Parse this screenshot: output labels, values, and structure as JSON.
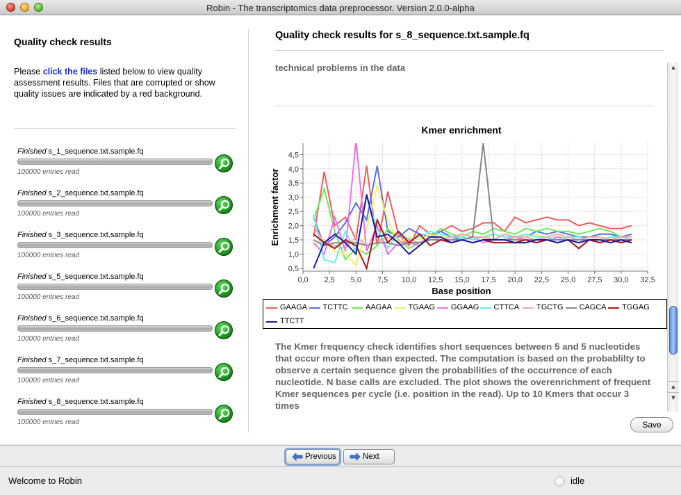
{
  "window": {
    "title": "Robin - The transcriptomics data preprocessor. Version 2.0.0-alpha"
  },
  "left": {
    "title": "Quality check results",
    "desc_prefix": "Please ",
    "desc_link": "click the files",
    "desc_suffix": " listed below to view quality assessment results. Files that are corrupted or show quality issues are indicated by a red background.",
    "files": [
      {
        "status": "Finished",
        "name": " s_1_sequence.txt.sample.fq",
        "entries": "100000 entries read"
      },
      {
        "status": "Finished",
        "name": " s_2_sequence.txt.sample.fq",
        "entries": "100000 entries read"
      },
      {
        "status": "Finished",
        "name": " s_3_sequence.txt.sample.fq",
        "entries": "100000 entries read"
      },
      {
        "status": "Finished",
        "name": " s_5_sequence.txt.sample.fq",
        "entries": "100000 entries read"
      },
      {
        "status": "Finished",
        "name": " s_6_sequence.txt.sample.fq",
        "entries": "100000 entries read"
      },
      {
        "status": "Finished",
        "name": " s_7_sequence.txt.sample.fq",
        "entries": "100000 entries read"
      },
      {
        "status": "Finished",
        "name": " s_8_sequence.txt.sample.fq",
        "entries": "100000 entries read"
      }
    ]
  },
  "right": {
    "title": "Quality check results for s_8_sequence.txt.sample.fq",
    "snippet": "technical problems in the data",
    "description": "The Kmer frequency check identifies short sequences between 5 and 5 nucleotides that occur more often than expected. The computation is based on the probablilty to observe a certain sequence given the probabilities of the occurrence of each nucleotide. N base calls are excluded. The plot shows the overenrichment of frequent Kmer sequences per cycle (i.e. position in the read). Up to 10 Kmers that occur 3 times",
    "save_label": "Save"
  },
  "nav": {
    "previous_label": "Previous",
    "next_label": "Next"
  },
  "status": {
    "message": "Welcome to Robin",
    "state": "idle"
  },
  "chart_data": {
    "type": "line",
    "title": "Kmer enrichment",
    "xlabel": "Base position",
    "ylabel": "Enrichment factor",
    "xlim": [
      0,
      32.5
    ],
    "ylim": [
      0.4,
      4.9
    ],
    "xticks": [
      "0,0",
      "2,5",
      "5,0",
      "7,5",
      "10,0",
      "12,5",
      "15,0",
      "17,5",
      "20,0",
      "22,5",
      "25,0",
      "27,5",
      "30,0",
      "32,5"
    ],
    "xtick_values": [
      0,
      2.5,
      5,
      7.5,
      10,
      12.5,
      15,
      17.5,
      20,
      22.5,
      25,
      27.5,
      30,
      32.5
    ],
    "yticks": [
      "0,5",
      "1,0",
      "1,5",
      "2,0",
      "2,5",
      "3,0",
      "3,5",
      "4,0",
      "4,5"
    ],
    "ytick_values": [
      0.5,
      1.0,
      1.5,
      2.0,
      2.5,
      3.0,
      3.5,
      4.0,
      4.5
    ],
    "grid": true,
    "legend_position": "bottom",
    "x": [
      1,
      2,
      3,
      4,
      5,
      6,
      7,
      8,
      9,
      10,
      11,
      12,
      13,
      14,
      15,
      16,
      17,
      18,
      19,
      20,
      21,
      22,
      23,
      24,
      25,
      26,
      27,
      28,
      29,
      30,
      31
    ],
    "series": [
      {
        "name": "GAAGA",
        "color": "#f25c5c",
        "values": [
          1.6,
          3.9,
          2.0,
          2.3,
          1.5,
          4.1,
          1.3,
          3.2,
          1.7,
          1.3,
          2.0,
          1.7,
          1.8,
          2.0,
          1.8,
          1.9,
          2.1,
          2.1,
          1.8,
          2.3,
          2.1,
          2.2,
          2.3,
          2.2,
          2.2,
          2.0,
          2.1,
          2.0,
          1.9,
          1.9,
          2.0
        ]
      },
      {
        "name": "TCTTC",
        "color": "#5a6ee6",
        "values": [
          2.3,
          1.3,
          1.6,
          2.1,
          2.8,
          2.2,
          4.1,
          1.8,
          1.6,
          1.9,
          1.7,
          1.6,
          1.8,
          1.6,
          1.5,
          1.6,
          1.6,
          1.5,
          1.7,
          1.6,
          1.6,
          1.8,
          1.7,
          1.8,
          1.7,
          1.6,
          1.6,
          1.7,
          1.7,
          1.6,
          1.7
        ]
      },
      {
        "name": "AAGAA",
        "color": "#66ee55",
        "values": [
          2.2,
          3.3,
          1.8,
          0.8,
          1.2,
          1.0,
          1.3,
          1.9,
          1.5,
          1.2,
          1.4,
          1.6,
          1.9,
          1.7,
          1.6,
          1.8,
          1.7,
          1.9,
          1.8,
          1.7,
          1.9,
          1.8,
          1.9,
          1.8,
          1.8,
          1.7,
          1.8,
          1.9,
          1.8,
          1.6,
          1.5
        ]
      },
      {
        "name": "TGAAG",
        "color": "#f4f060",
        "values": [
          1.3,
          1.5,
          1.1,
          1.0,
          0.6,
          1.9,
          3.4,
          2.2,
          1.4,
          1.6,
          1.5,
          1.7,
          1.6,
          1.6,
          1.7,
          1.6,
          1.5,
          1.7,
          1.6,
          1.5,
          1.6,
          1.7,
          1.5,
          1.6,
          1.6,
          1.5,
          1.6,
          1.5,
          1.6,
          1.5,
          1.5
        ]
      },
      {
        "name": "GGAAG",
        "color": "#f46cf4",
        "values": [
          1.4,
          1.0,
          2.3,
          1.1,
          5.0,
          1.1,
          2.0,
          1.0,
          1.4,
          1.4,
          1.3,
          1.6,
          1.5,
          1.5,
          1.5,
          1.6,
          1.4,
          1.5,
          1.5,
          1.6,
          1.5,
          1.4,
          1.5,
          1.6,
          1.5,
          1.4,
          1.5,
          1.4,
          1.5,
          1.4,
          1.5
        ]
      },
      {
        "name": "CTTCA",
        "color": "#66eeee",
        "values": [
          2.4,
          0.8,
          0.7,
          1.8,
          1.1,
          3.0,
          1.9,
          1.2,
          1.8,
          1.5,
          1.6,
          1.8,
          1.7,
          1.6,
          1.6,
          1.5,
          1.6,
          1.7,
          1.6,
          1.6,
          1.7,
          1.6,
          1.6,
          1.5,
          1.6,
          1.6,
          1.5,
          1.5,
          1.6,
          1.6,
          1.5
        ]
      },
      {
        "name": "TGCTG",
        "color": "#f4a8a8",
        "values": [
          2.0,
          1.4,
          1.3,
          1.2,
          1.6,
          1.3,
          1.4,
          1.6,
          1.4,
          1.5,
          1.4,
          1.6,
          1.5,
          1.6,
          1.7,
          1.6,
          1.6,
          1.5,
          1.7,
          1.6,
          1.6,
          1.5,
          1.6,
          1.7,
          1.6,
          1.5,
          1.6,
          1.6,
          1.5,
          1.6,
          1.6
        ]
      },
      {
        "name": "CAGCA",
        "color": "#888888",
        "values": [
          1.5,
          1.3,
          1.4,
          1.4,
          1.4,
          1.3,
          1.4,
          1.4,
          1.3,
          1.4,
          1.4,
          1.5,
          1.5,
          1.5,
          1.5,
          1.6,
          4.9,
          1.5,
          1.5,
          1.5,
          1.5,
          1.5,
          1.5,
          1.5,
          1.5,
          1.5,
          1.5,
          1.5,
          1.5,
          1.5,
          1.5
        ]
      },
      {
        "name": "TGGAG",
        "color": "#b01010",
        "values": [
          1.7,
          1.4,
          1.2,
          1.5,
          1.3,
          0.5,
          2.2,
          1.4,
          1.8,
          1.4,
          1.7,
          1.3,
          1.5,
          1.4,
          1.5,
          1.4,
          1.5,
          1.4,
          1.4,
          1.4,
          1.5,
          1.4,
          1.5,
          1.4,
          1.5,
          1.2,
          1.5,
          1.4,
          1.5,
          1.4,
          1.5
        ]
      },
      {
        "name": "TTCTT",
        "color": "#1a1aa8",
        "values": [
          0.5,
          1.4,
          1.7,
          1.4,
          1.0,
          3.1,
          1.6,
          1.7,
          1.4,
          1.0,
          1.3,
          1.6,
          1.6,
          1.4,
          1.5,
          1.4,
          1.5,
          1.5,
          1.5,
          1.4,
          1.4,
          1.5,
          1.5,
          1.4,
          1.5,
          1.4,
          1.5,
          1.5,
          1.4,
          1.5,
          1.4
        ]
      }
    ]
  }
}
